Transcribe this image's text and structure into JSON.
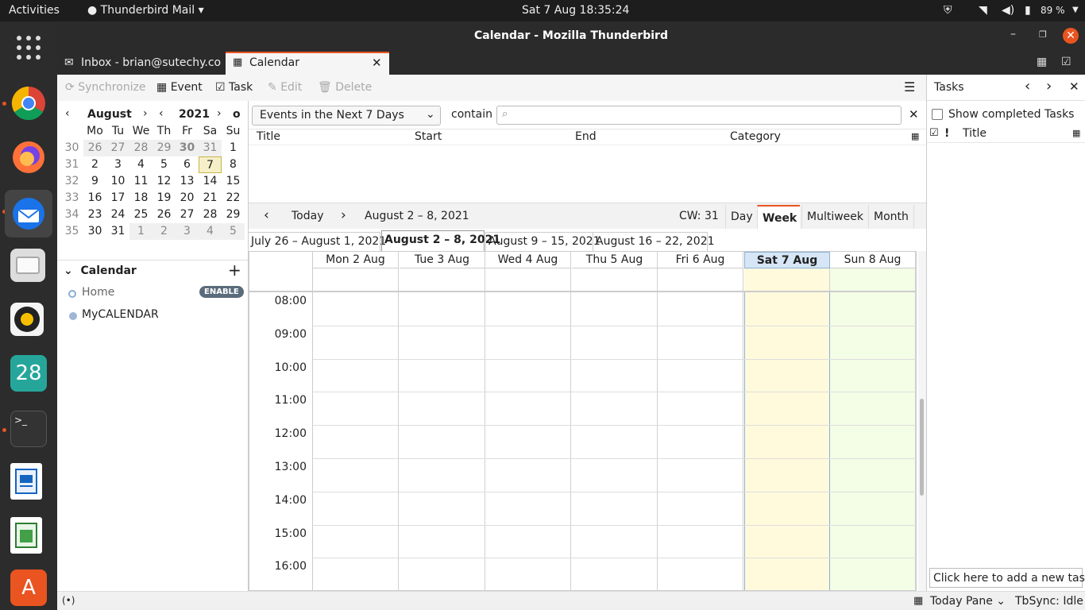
{
  "topbar": {
    "activities": "Activities",
    "app_menu": "Thunderbird Mail",
    "clock": "Sat 7 Aug  18:35:24",
    "battery": "89 %"
  },
  "window": {
    "title": "Calendar - Mozilla Thunderbird"
  },
  "tabs": [
    {
      "label": "Inbox - brian@sutechy.com"
    },
    {
      "label": "Calendar"
    }
  ],
  "toolbar": {
    "sync": "Synchronize",
    "event": "Event",
    "task": "Task",
    "edit": "Edit",
    "delete": "Delete"
  },
  "minical": {
    "month": "August",
    "year": "2021",
    "weekdays": [
      "Mo",
      "Tu",
      "We",
      "Th",
      "Fr",
      "Sa",
      "Su"
    ],
    "weeks": [
      {
        "num": "30",
        "days": [
          "26",
          "27",
          "28",
          "29",
          "30",
          "31",
          "1"
        ]
      },
      {
        "num": "31",
        "days": [
          "2",
          "3",
          "4",
          "5",
          "6",
          "7",
          "8"
        ]
      },
      {
        "num": "32",
        "days": [
          "9",
          "10",
          "11",
          "12",
          "13",
          "14",
          "15"
        ]
      },
      {
        "num": "33",
        "days": [
          "16",
          "17",
          "18",
          "19",
          "20",
          "21",
          "22"
        ]
      },
      {
        "num": "34",
        "days": [
          "23",
          "24",
          "25",
          "26",
          "27",
          "28",
          "29"
        ]
      },
      {
        "num": "35",
        "days": [
          "30",
          "31",
          "1",
          "2",
          "3",
          "4",
          "5"
        ]
      }
    ],
    "today": "7"
  },
  "calendars": {
    "header": "Calendar",
    "items": [
      {
        "name": "Home",
        "badge": "ENABLE"
      },
      {
        "name": "MyCALENDAR"
      }
    ]
  },
  "filter": {
    "selected": "Events in the Next 7 Days",
    "contain_label": "contain",
    "search_placeholder": ""
  },
  "list_columns": [
    "Title",
    "Start",
    "End",
    "Category"
  ],
  "nav": {
    "today": "Today",
    "range": "August 2 – 8, 2021",
    "cw": "CW: 31",
    "views": [
      "Day",
      "Week",
      "Multiweek",
      "Month"
    ],
    "active_view": "Week"
  },
  "week_tabs": [
    "July 26 – August 1, 2021",
    "August 2 – 8, 2021",
    "August 9 – 15, 2021",
    "August 16 – 22, 2021"
  ],
  "days": [
    "Mon 2 Aug",
    "Tue 3 Aug",
    "Wed 4 Aug",
    "Thu 5 Aug",
    "Fri 6 Aug",
    "Sat 7 Aug",
    "Sun 8 Aug"
  ],
  "hours": [
    "08:00",
    "09:00",
    "10:00",
    "11:00",
    "12:00",
    "13:00",
    "14:00",
    "15:00",
    "16:00"
  ],
  "tasks": {
    "title": "Tasks",
    "show_completed": "Show completed Tasks",
    "col_priority": "!",
    "col_title": "Title",
    "add_task": "Click here to add a new task"
  },
  "status": {
    "today_pane": "Today Pane",
    "tbsync": "TbSync: Idle"
  },
  "colors": {
    "accent": "#e95420",
    "today_bg": "#fffadc",
    "weekend_bg": "#f4fde6"
  }
}
